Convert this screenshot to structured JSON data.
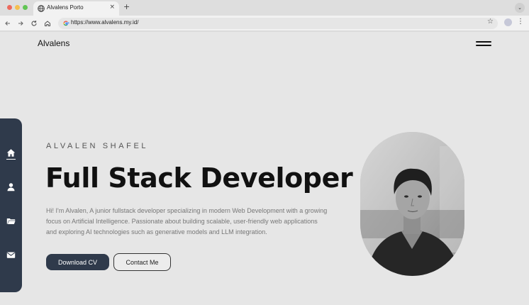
{
  "browser": {
    "tab_title": "Alvalens Porto",
    "tab_close": "×",
    "new_tab": "+",
    "url": "https://www.alvalens.my.id/",
    "icons": {
      "back": "back-arrow-icon",
      "forward": "forward-arrow-icon",
      "reload": "reload-icon",
      "home": "home-icon",
      "star": "bookmark-star-icon",
      "menu": "kebab-menu-icon"
    }
  },
  "site": {
    "logo": "Alvalens",
    "subtitle": "ALVALEN SHAFEL",
    "headline": "Full Stack Developer",
    "intro": "Hi! I'm Alvalen, A junior fullstack developer specializing in modern Web Development with a growing focus on Artificial Intelligence. Passionate about building scalable, user-friendly web applications and exploring AI technologies such as generative models and LLM integration.",
    "buttons": {
      "download": "Download CV",
      "contact": "Contact Me"
    },
    "sidenav": [
      "home-icon",
      "user-icon",
      "folder-icon",
      "mail-icon"
    ]
  },
  "colors": {
    "accent": "#2f3a4b",
    "page_bg": "#e6e6e6",
    "text": "#111111",
    "muted": "#777777"
  }
}
